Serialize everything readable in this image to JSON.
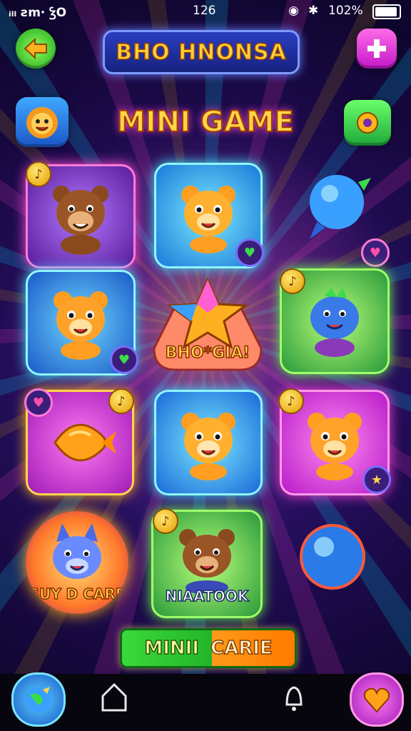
{
  "status_bar": {
    "left": "ᵢₗₗ ƨm· ꝢO",
    "time": "126",
    "battery": "102%"
  },
  "header": {
    "title": "BHO HNONSA",
    "back_icon": "back-arrow-icon",
    "add_icon": "plus-icon"
  },
  "subheader": {
    "title": "MINI GAME"
  },
  "cards": [
    {
      "name": "bear-card",
      "label": ""
    },
    {
      "name": "cat-card",
      "label": ""
    },
    {
      "name": "balloon-card",
      "label": ""
    },
    {
      "name": "lion-cub-card",
      "label": ""
    },
    {
      "name": "star-card",
      "label": "BHO*GIA!"
    },
    {
      "name": "dino-card",
      "label": ""
    },
    {
      "name": "fish-card",
      "label": ""
    },
    {
      "name": "tiger-card",
      "label": ""
    },
    {
      "name": "puppy-card",
      "label": ""
    },
    {
      "name": "wolf-card",
      "label": "SUY D CARE"
    },
    {
      "name": "brown-bear-card",
      "label": "NIAATOOK"
    },
    {
      "name": "ball-card",
      "label": ""
    }
  ],
  "play_button": {
    "left": "MINII",
    "right": "CARIE"
  },
  "colors": {
    "accent_yellow": "#ffd54a",
    "cyan_glow": "#3ee6ff",
    "magenta_glow": "#ff3fd8",
    "green_glow": "#6cff4a"
  }
}
